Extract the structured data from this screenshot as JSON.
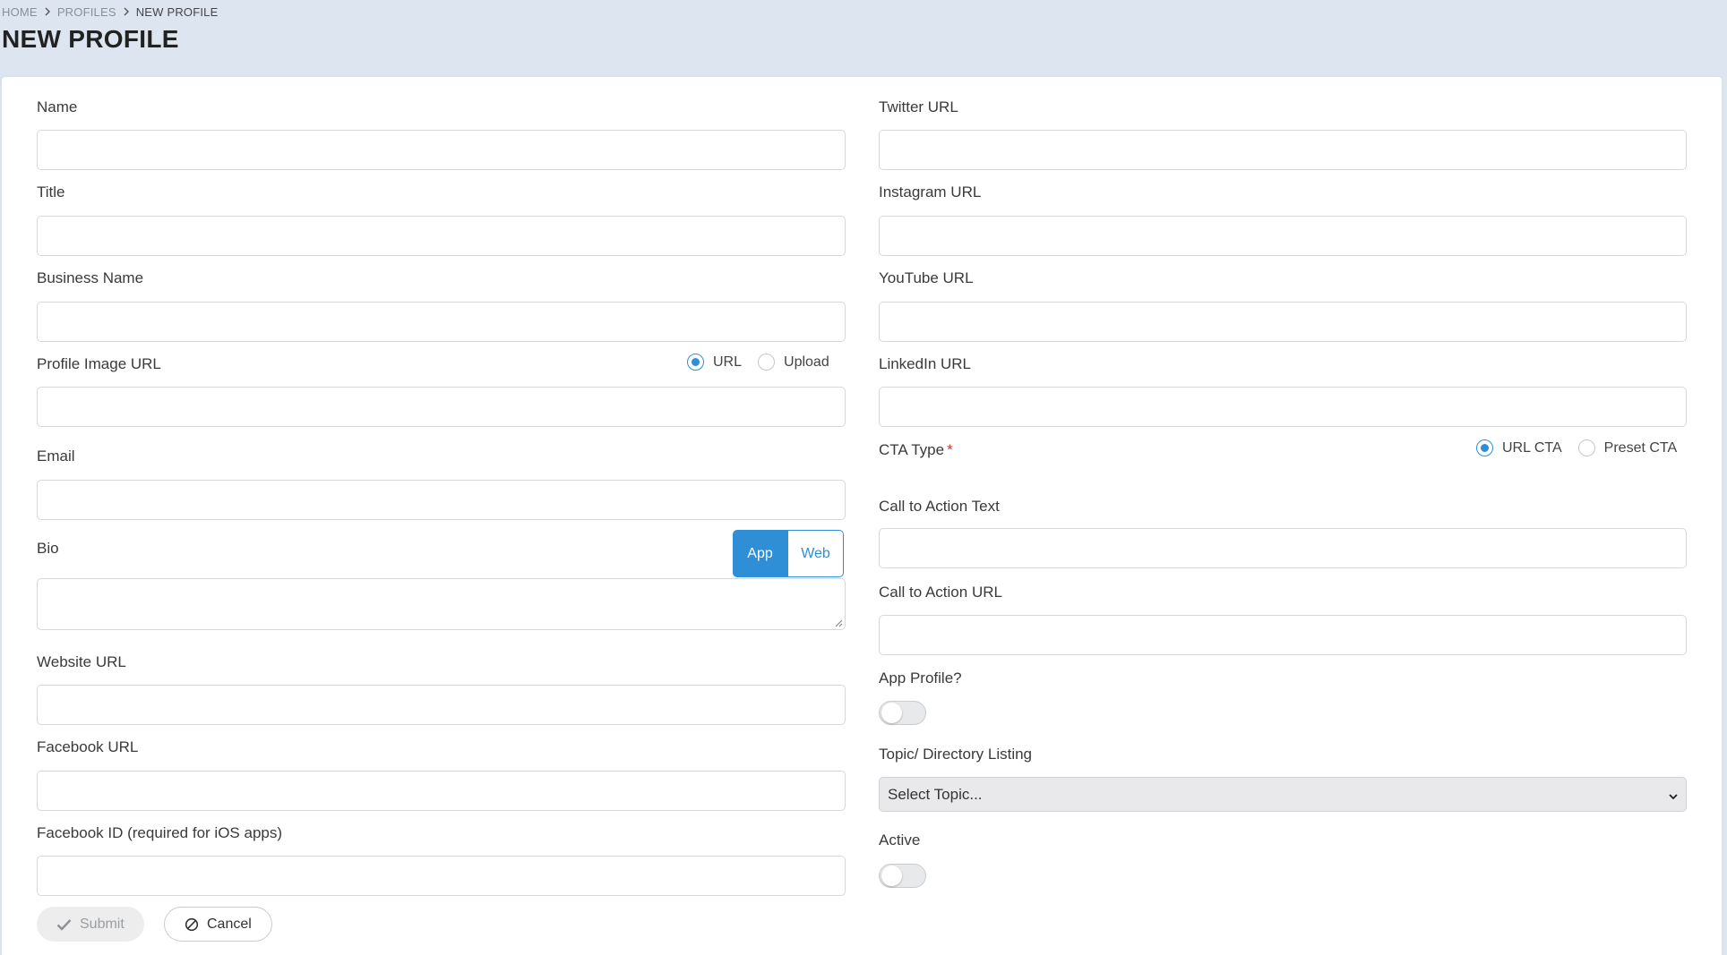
{
  "breadcrumb": {
    "home": "HOME",
    "profiles": "PROFILES",
    "current": "NEW PROFILE"
  },
  "page": {
    "title": "NEW PROFILE"
  },
  "left": {
    "name_label": "Name",
    "title_label": "Title",
    "business_label": "Business Name",
    "image_label": "Profile Image URL",
    "image_mode": {
      "url_label": "URL",
      "upload_label": "Upload",
      "selected": "URL"
    },
    "email_label": "Email",
    "bio_label": "Bio",
    "bio_mode": {
      "app_label": "App",
      "web_label": "Web",
      "selected": "App"
    },
    "website_label": "Website URL",
    "facebook_label": "Facebook URL",
    "facebook_id_label": "Facebook ID (required for iOS apps)"
  },
  "right": {
    "twitter_label": "Twitter URL",
    "instagram_label": "Instagram URL",
    "youtube_label": "YouTube URL",
    "linkedin_label": "LinkedIn URL",
    "cta_type_label": "CTA Type",
    "cta_required_mark": "*",
    "cta_type": {
      "url_cta_label": "URL CTA",
      "preset_cta_label": "Preset CTA",
      "selected": "URL CTA"
    },
    "cta_text_label": "Call to Action Text",
    "cta_url_label": "Call to Action URL",
    "app_profile_label": "App Profile?",
    "app_profile_on": false,
    "topic_label": "Topic/ Directory Listing",
    "topic_selected": "Select Topic...",
    "active_label": "Active",
    "active_on": false
  },
  "actions": {
    "submit_label": "Submit",
    "cancel_label": "Cancel"
  },
  "colors": {
    "accent": "#2f8fd6",
    "header_bg": "#dde6f0",
    "required": "#d9322b"
  },
  "icons": {
    "submit": "check-icon",
    "cancel": "ban-icon",
    "select": "chevron-down-icon",
    "breadcrumb_sep": "chevron-right-icon"
  }
}
